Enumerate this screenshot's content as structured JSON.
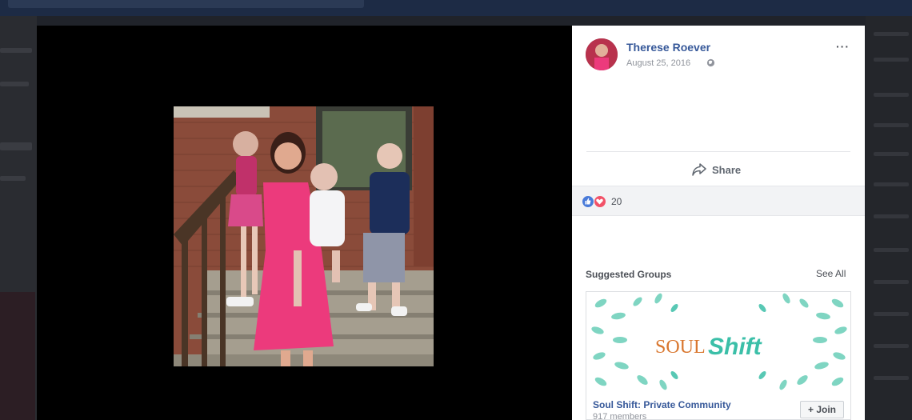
{
  "post": {
    "author": "Therese Roever",
    "date": "August 25, 2016",
    "more_label": "···",
    "share_label": "Share",
    "reaction_count": "20"
  },
  "suggested_groups": {
    "title": "Suggested Groups",
    "see_all_label": "See All",
    "group": {
      "logo_text_soul": "SOUL",
      "logo_text_shift": "Shift",
      "name": "Soul Shift: Private Community",
      "members": "917 members",
      "join_label": "+ Join"
    }
  },
  "icons": {
    "globe": "globe-icon",
    "share": "share-arrow-icon",
    "like": "like-reaction-icon",
    "love": "love-reaction-icon"
  },
  "colors": {
    "link_blue": "#365899",
    "logo_teal": "#3bbfa8",
    "logo_orange": "#d9772f",
    "love_red": "#f25268",
    "like_blue": "#4a7bd9"
  }
}
